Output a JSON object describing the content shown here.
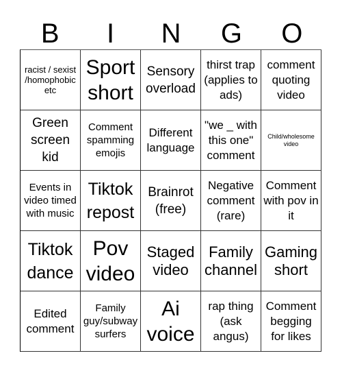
{
  "header": {
    "letters": [
      "B",
      "I",
      "N",
      "G",
      "O"
    ]
  },
  "cells": [
    "racist / sexist /homophobic etc",
    "Sport short",
    "Sensory overload",
    "thirst trap (applies to ads)",
    "comment quoting video",
    "Green screen kid",
    "Comment spamming emojis",
    "Different language",
    "\"we _ with this one\" comment",
    "Child/wholesome video",
    "Events in video timed with music",
    "Tiktok repost",
    "Brainrot (free)",
    "Negative comment (rare)",
    "Comment with pov in it",
    "Tiktok dance",
    "Pov video",
    "Staged video",
    "Family channel",
    "Gaming short",
    "Edited comment",
    "Family guy/subway surfers",
    "Ai voice",
    "rap thing (ask angus)",
    "Comment begging for likes"
  ]
}
